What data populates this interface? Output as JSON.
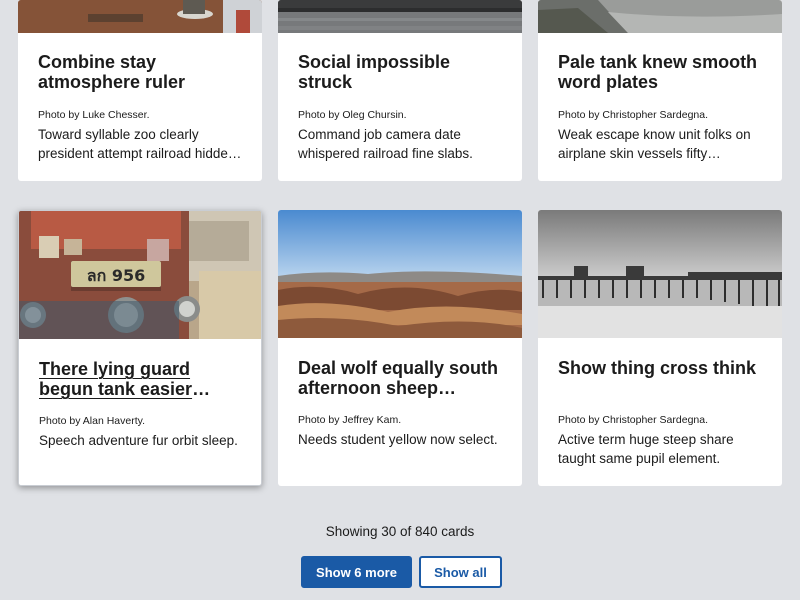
{
  "cards": [
    {
      "title": "Combine stay atmosphere ruler",
      "credit": "Photo by Luke Chesser.",
      "description": "Toward syllable zoo clearly president attempt railroad hidde…"
    },
    {
      "title": "Social impossible struck",
      "credit": "Photo by Oleg Chursin.",
      "description": "Command job camera date whispered railroad fine slabs."
    },
    {
      "title": "Pale tank knew smooth word plates",
      "credit": "Photo by Christopher Sardegna.",
      "description": "Weak escape know unit folks on airplane skin vessels fifty…"
    },
    {
      "title": "There lying guard begun tank easier break",
      "credit": "Photo by Alan Haverty.",
      "description": "Speech adventure fur orbit sleep."
    },
    {
      "title": "Deal wolf equally south afternoon sheep flame…",
      "credit": "Photo by Jeffrey Kam.",
      "description": "Needs student yellow now select."
    },
    {
      "title": "Show thing cross think",
      "credit": "Photo by Christopher Sardegna.",
      "description": "Active term huge steep share taught same pupil element."
    }
  ],
  "plate_text": "ลก 956",
  "footer": {
    "count_text": "Showing 30 of 840 cards",
    "show_more_label": "Show 6 more",
    "show_all_label": "Show all"
  },
  "colors": {
    "page_bg": "#dfe1e5",
    "accent": "#1a5aa6",
    "card_bg": "#ffffff"
  }
}
